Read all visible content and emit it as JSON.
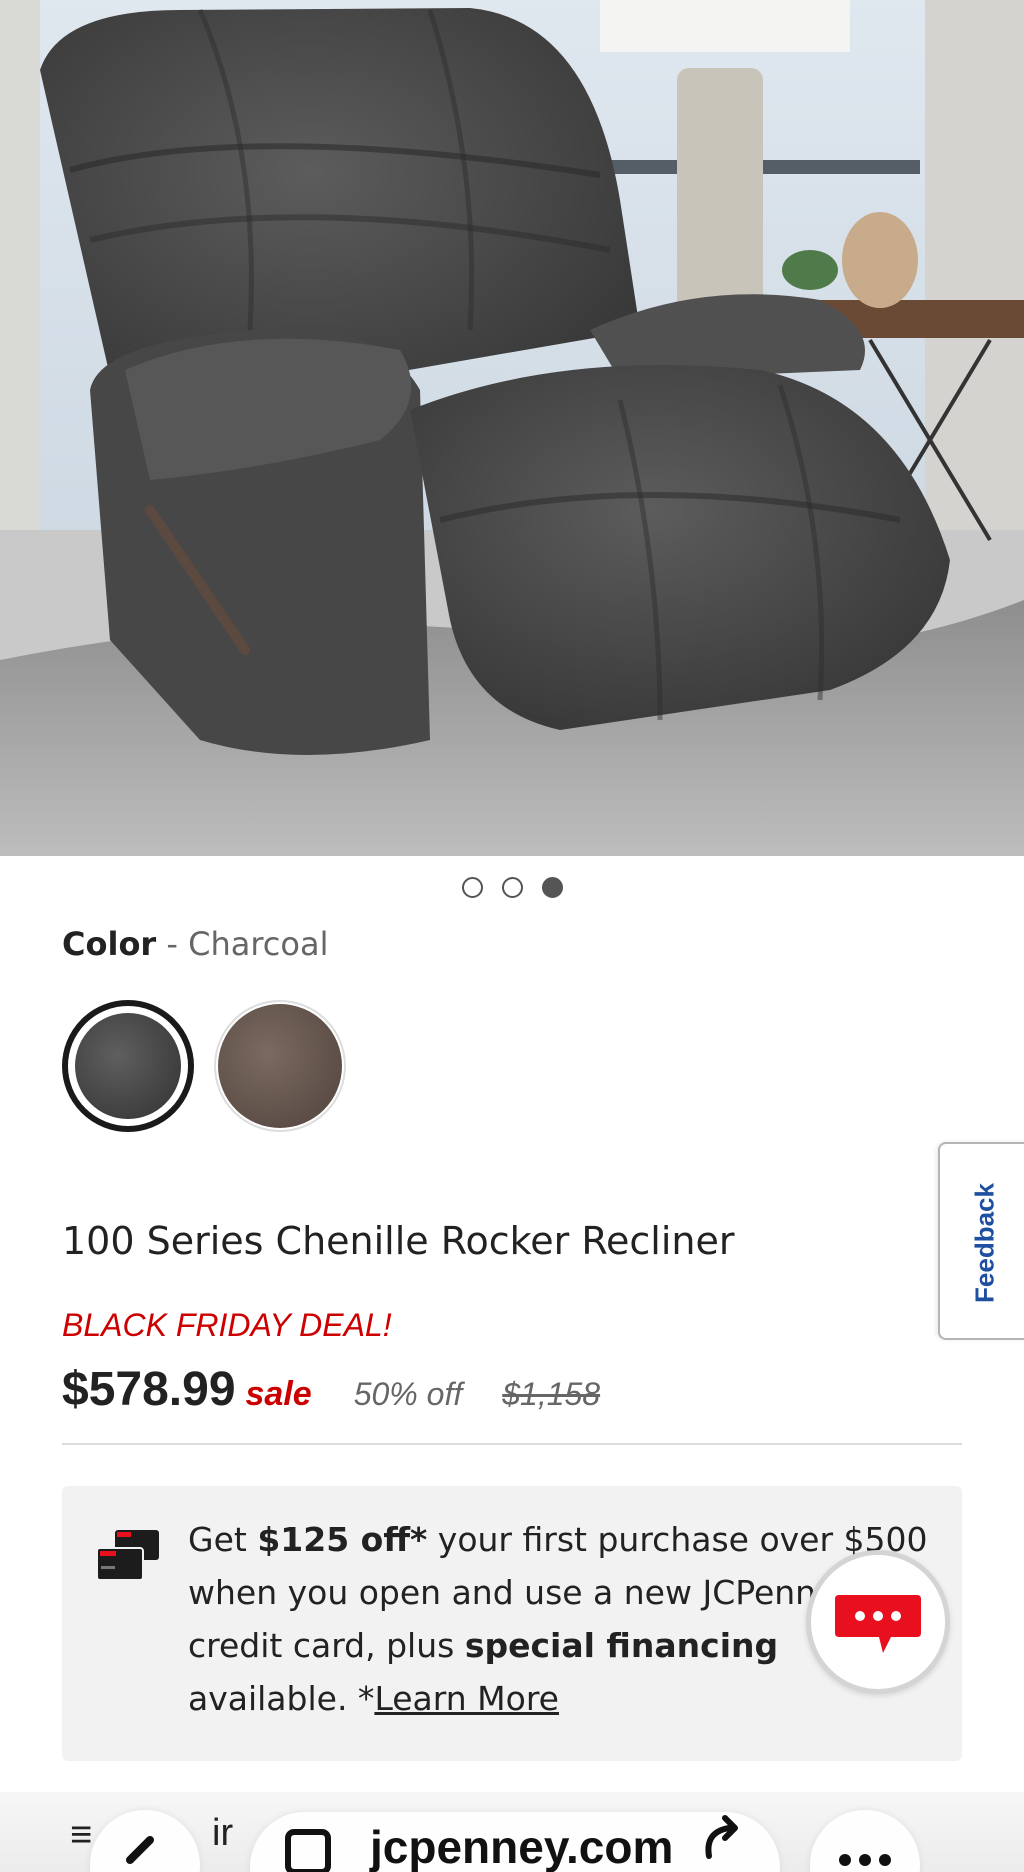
{
  "gallery": {
    "dot_count": 3,
    "active_index": 2
  },
  "color": {
    "label": "Color",
    "separator": " - ",
    "selected": "Charcoal",
    "swatches": [
      {
        "name": "Charcoal",
        "hex": "#4a4a4a",
        "selected": true
      },
      {
        "name": "Brown",
        "hex": "#6a5a52",
        "selected": false
      }
    ]
  },
  "feedback": {
    "label": "Feedback"
  },
  "product": {
    "title": "100 Series Chenille Rocker Recliner",
    "deal_label": "BLACK FRIDAY DEAL!",
    "price": "$578.99",
    "sale_label": "sale",
    "discount": "50% off",
    "original_price": "$1,158"
  },
  "promo": {
    "text_1": "Get ",
    "bold_1": "$125 off*",
    "text_2": " your first purchase over $500 when you open and use a new JCPenney credit card, plus ",
    "bold_2": "special financing",
    "text_3": " available. *",
    "link": "Learn More",
    "icon": "credit-card-icon"
  },
  "chat": {
    "icon": "chat-icon"
  },
  "browser": {
    "url": "jcpenney.com",
    "tab_hint": "ir"
  },
  "colors": {
    "accent_red": "#cc0000",
    "feedback_blue": "#1e4fa0",
    "chat_red": "#e8101e"
  }
}
